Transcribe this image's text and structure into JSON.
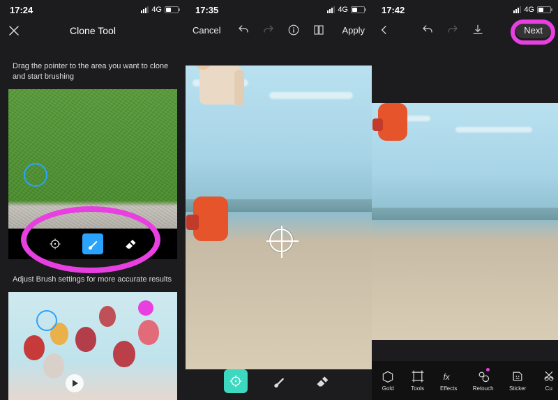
{
  "panel1": {
    "status_time": "17:24",
    "network_label": "4G",
    "header": {
      "title": "Clone Tool"
    },
    "card1_instruction": "Drag the pointer to the area you want to clone and start brushing",
    "card2_instruction": "Adjust Brush settings for more accurate results",
    "tools": {
      "target": "target-tool",
      "brush": "brush-tool",
      "eraser": "eraser-tool",
      "active": "brush"
    }
  },
  "panel2": {
    "status_time": "17:35",
    "network_label": "4G",
    "header": {
      "cancel": "Cancel",
      "apply": "Apply"
    },
    "tools": {
      "target": "target-tool",
      "brush": "brush-tool",
      "eraser": "eraser-tool",
      "active": "target"
    }
  },
  "panel3": {
    "status_time": "17:42",
    "network_label": "4G",
    "header": {
      "next": "Next"
    },
    "bottombar": {
      "items": [
        {
          "label": "Gold"
        },
        {
          "label": "Tools"
        },
        {
          "label": "Effects"
        },
        {
          "label": "Retouch"
        },
        {
          "label": "Sticker"
        },
        {
          "label": "Cu"
        }
      ],
      "dot_on": "Retouch"
    }
  },
  "annotation_color": "#e83fe0"
}
